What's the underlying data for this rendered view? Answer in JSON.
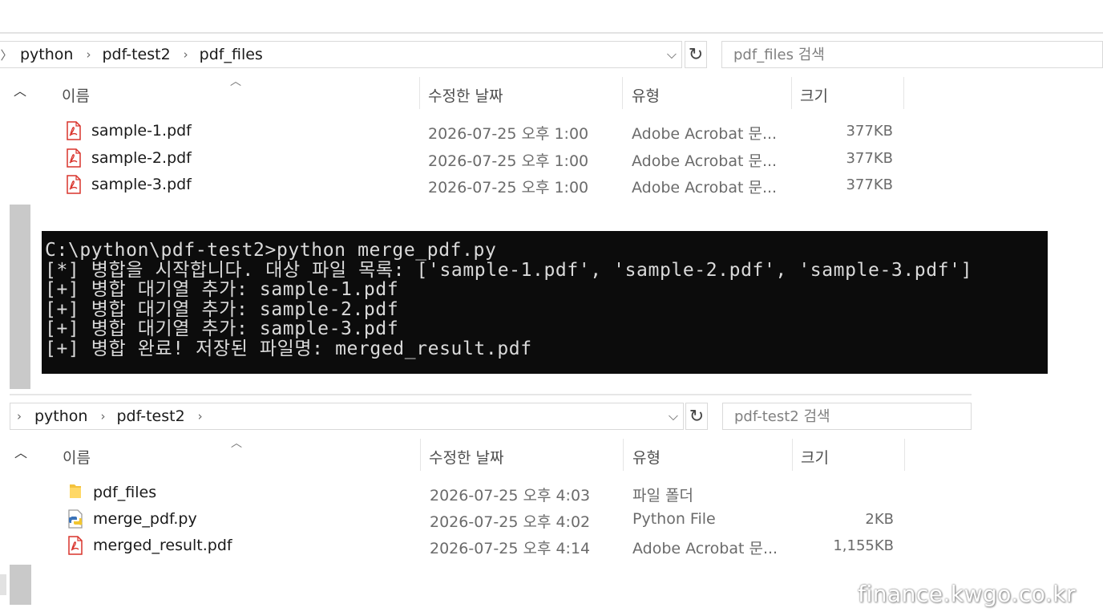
{
  "upper_window": {
    "breadcrumbs": [
      "python",
      "pdf-test2",
      "pdf_files"
    ],
    "search_placeholder": "pdf_files 검색",
    "columns": {
      "name": "이름",
      "date": "수정한 날짜",
      "type": "유형",
      "size": "크기"
    },
    "files": [
      {
        "icon": "pdf-file-icon",
        "name": "sample-1.pdf",
        "date": "2026-07-25 오후 1:00",
        "type": "Adobe Acrobat 문...",
        "size": "377KB"
      },
      {
        "icon": "pdf-file-icon",
        "name": "sample-2.pdf",
        "date": "2026-07-25 오후 1:00",
        "type": "Adobe Acrobat 문...",
        "size": "377KB"
      },
      {
        "icon": "pdf-file-icon",
        "name": "sample-3.pdf",
        "date": "2026-07-25 오후 1:00",
        "type": "Adobe Acrobat 문...",
        "size": "377KB"
      }
    ]
  },
  "console": {
    "lines": [
      "C:\\python\\pdf-test2>python merge_pdf.py",
      "[*] 병합을 시작합니다. 대상 파일 목록: ['sample-1.pdf', 'sample-2.pdf', 'sample-3.pdf']",
      "[+] 병합 대기열 추가: sample-1.pdf",
      "[+] 병합 대기열 추가: sample-2.pdf",
      "[+] 병합 대기열 추가: sample-3.pdf",
      "[+] 병합 완료! 저장된 파일명: merged_result.pdf"
    ]
  },
  "lower_window": {
    "breadcrumbs": [
      "python",
      "pdf-test2"
    ],
    "search_placeholder": "pdf-test2 검색",
    "columns": {
      "name": "이름",
      "date": "수정한 날짜",
      "type": "유형",
      "size": "크기"
    },
    "files": [
      {
        "icon": "folder-icon",
        "name": "pdf_files",
        "date": "2026-07-25 오후 4:03",
        "type": "파일 폴더",
        "size": ""
      },
      {
        "icon": "python-file-icon",
        "name": "merge_pdf.py",
        "date": "2026-07-25 오후 4:02",
        "type": "Python File",
        "size": "2KB"
      },
      {
        "icon": "pdf-file-icon",
        "name": "merged_result.pdf",
        "date": "2026-07-25 오후 4:14",
        "type": "Adobe Acrobat 문...",
        "size": "1,155KB"
      }
    ]
  },
  "watermark": "finance.kwgo.co.kr",
  "colors": {
    "pdf_red": "#d9332b",
    "folder_yellow": "#f4c23d",
    "console_bg": "#0c0c0c",
    "console_fg": "#dadada"
  }
}
